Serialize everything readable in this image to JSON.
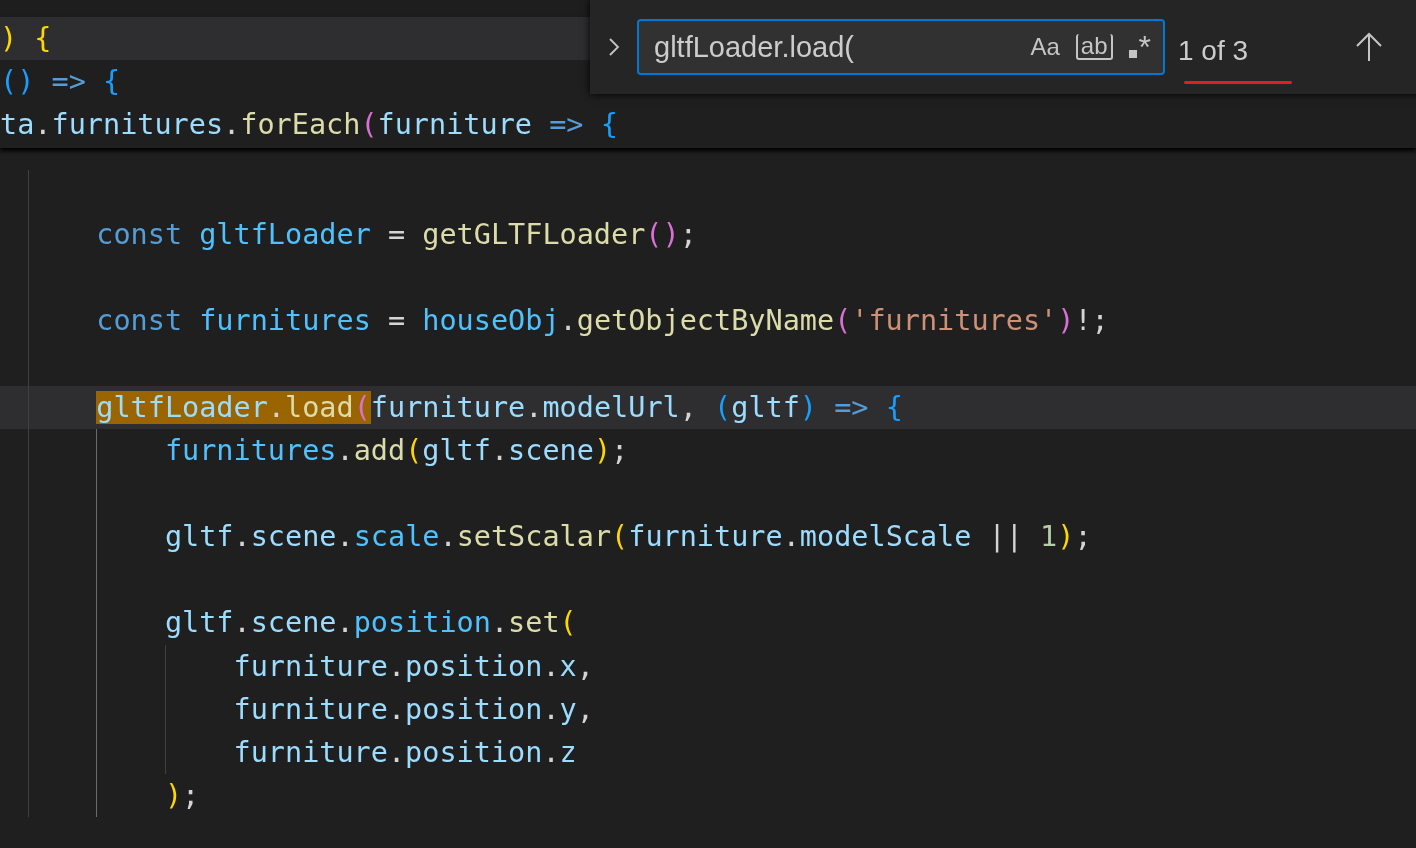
{
  "sticky_lines": [
    {
      "current": true,
      "tokens": [
        {
          "text": ")",
          "kind": "b1"
        },
        {
          "text": " {",
          "kind": "b1"
        }
      ]
    },
    {
      "current": false,
      "tokens": [
        {
          "text": "()",
          "kind": "b3"
        },
        {
          "text": " =>",
          "kind": "kw"
        },
        {
          "text": " {",
          "kind": "b3"
        }
      ]
    },
    {
      "current": false,
      "tokens": [
        {
          "text": "ta",
          "kind": "prop"
        },
        {
          "text": ".",
          "kind": "op"
        },
        {
          "text": "furnitures",
          "kind": "prop"
        },
        {
          "text": ".",
          "kind": "op"
        },
        {
          "text": "forEach",
          "kind": "fn"
        },
        {
          "text": "(",
          "kind": "b2"
        },
        {
          "text": "furniture",
          "kind": "prop"
        },
        {
          "text": " =>",
          "kind": "kw"
        },
        {
          "text": " {",
          "kind": "b3"
        }
      ]
    }
  ],
  "lines": [
    {
      "current": false
    },
    {
      "current": false,
      "tokens": [
        {
          "text": "const",
          "kind": "kw"
        },
        {
          "text": " gltfLoader",
          "kind": "var"
        },
        {
          "text": " = ",
          "kind": "op"
        },
        {
          "text": "getGLTFLoader",
          "kind": "fn"
        },
        {
          "text": "()",
          "kind": "b2"
        },
        {
          "text": ";",
          "kind": "op"
        }
      ]
    },
    {
      "current": false
    },
    {
      "current": false,
      "tokens": [
        {
          "text": "const",
          "kind": "kw"
        },
        {
          "text": " furnitures",
          "kind": "var"
        },
        {
          "text": " = ",
          "kind": "op"
        },
        {
          "text": "houseObj",
          "kind": "var"
        },
        {
          "text": ".",
          "kind": "op"
        },
        {
          "text": "getObjectByName",
          "kind": "fn"
        },
        {
          "text": "(",
          "kind": "b2"
        },
        {
          "text": "'furnitures'",
          "kind": "str"
        },
        {
          "text": ")",
          "kind": "b2"
        },
        {
          "text": "!;",
          "kind": "op"
        }
      ]
    },
    {
      "current": false
    },
    {
      "current": true,
      "match": [
        {
          "text": "gltfLoader",
          "kind": "prop"
        },
        {
          "text": ".",
          "kind": "op"
        },
        {
          "text": "load",
          "kind": "fn"
        },
        {
          "text": "(",
          "kind": "b2"
        }
      ],
      "tokens": [
        {
          "text": "furniture",
          "kind": "prop"
        },
        {
          "text": ".",
          "kind": "op"
        },
        {
          "text": "modelUrl",
          "kind": "prop"
        },
        {
          "text": ", ",
          "kind": "op"
        },
        {
          "text": "(",
          "kind": "b3"
        },
        {
          "text": "gltf",
          "kind": "prop"
        },
        {
          "text": ")",
          "kind": "b3"
        },
        {
          "text": " =>",
          "kind": "kw"
        },
        {
          "text": " {",
          "kind": "b3"
        }
      ],
      "children": [
        {
          "current": false,
          "tokens": [
            {
              "text": "furnitures",
              "kind": "var"
            },
            {
              "text": ".",
              "kind": "op"
            },
            {
              "text": "add",
              "kind": "fn"
            },
            {
              "text": "(",
              "kind": "b1"
            },
            {
              "text": "gltf",
              "kind": "prop"
            },
            {
              "text": ".",
              "kind": "op"
            },
            {
              "text": "scene",
              "kind": "prop"
            },
            {
              "text": ")",
              "kind": "b1"
            },
            {
              "text": ";",
              "kind": "op"
            }
          ]
        },
        {
          "current": false
        },
        {
          "current": false,
          "tokens": [
            {
              "text": "gltf",
              "kind": "prop"
            },
            {
              "text": ".",
              "kind": "op"
            },
            {
              "text": "scene",
              "kind": "prop"
            },
            {
              "text": ".",
              "kind": "op"
            },
            {
              "text": "scale",
              "kind": "var"
            },
            {
              "text": ".",
              "kind": "op"
            },
            {
              "text": "setScalar",
              "kind": "fn"
            },
            {
              "text": "(",
              "kind": "b1"
            },
            {
              "text": "furniture",
              "kind": "prop"
            },
            {
              "text": ".",
              "kind": "op"
            },
            {
              "text": "modelScale",
              "kind": "prop"
            },
            {
              "text": " || ",
              "kind": "op"
            },
            {
              "text": "1",
              "kind": "num"
            },
            {
              "text": ")",
              "kind": "b1"
            },
            {
              "text": ";",
              "kind": "op"
            }
          ]
        },
        {
          "current": false
        },
        {
          "current": false,
          "tokens": [
            {
              "text": "gltf",
              "kind": "prop"
            },
            {
              "text": ".",
              "kind": "op"
            },
            {
              "text": "scene",
              "kind": "prop"
            },
            {
              "text": ".",
              "kind": "op"
            },
            {
              "text": "position",
              "kind": "var"
            },
            {
              "text": ".",
              "kind": "op"
            },
            {
              "text": "set",
              "kind": "fn"
            },
            {
              "text": "(",
              "kind": "b1"
            }
          ],
          "children": [
            {
              "current": false,
              "tokens": [
                {
                  "text": "furniture",
                  "kind": "prop"
                },
                {
                  "text": ".",
                  "kind": "op"
                },
                {
                  "text": "position",
                  "kind": "prop"
                },
                {
                  "text": ".",
                  "kind": "op"
                },
                {
                  "text": "x",
                  "kind": "prop"
                },
                {
                  "text": ",",
                  "kind": "op"
                }
              ]
            },
            {
              "current": false,
              "tokens": [
                {
                  "text": "furniture",
                  "kind": "prop"
                },
                {
                  "text": ".",
                  "kind": "op"
                },
                {
                  "text": "position",
                  "kind": "prop"
                },
                {
                  "text": ".",
                  "kind": "op"
                },
                {
                  "text": "y",
                  "kind": "prop"
                },
                {
                  "text": ",",
                  "kind": "op"
                }
              ]
            },
            {
              "current": false,
              "tokens": [
                {
                  "text": "furniture",
                  "kind": "prop"
                },
                {
                  "text": ".",
                  "kind": "op"
                },
                {
                  "text": "position",
                  "kind": "prop"
                },
                {
                  "text": ".",
                  "kind": "op"
                },
                {
                  "text": "z",
                  "kind": "prop"
                }
              ]
            }
          ]
        },
        {
          "current": false,
          "tokens": [
            {
              "text": ")",
              "kind": "b1"
            },
            {
              "text": ";",
              "kind": "op"
            }
          ]
        }
      ]
    }
  ],
  "find_widget": {
    "query": "gltfLoader.load(",
    "toggles": [
      {
        "label": "Aa",
        "kind": "case",
        "selected": false
      },
      {
        "label": "ab",
        "kind": "word",
        "selected": false
      },
      {
        "label": "*",
        "kind": "regex",
        "selected": false
      }
    ],
    "count": "1 of 3",
    "count_underlined": true
  }
}
